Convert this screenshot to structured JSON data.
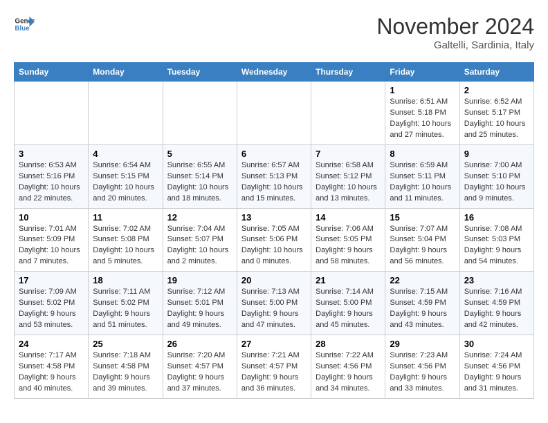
{
  "header": {
    "logo_line1": "General",
    "logo_line2": "Blue",
    "month": "November 2024",
    "location": "Galtelli, Sardinia, Italy"
  },
  "weekdays": [
    "Sunday",
    "Monday",
    "Tuesday",
    "Wednesday",
    "Thursday",
    "Friday",
    "Saturday"
  ],
  "weeks": [
    [
      {
        "day": "",
        "info": ""
      },
      {
        "day": "",
        "info": ""
      },
      {
        "day": "",
        "info": ""
      },
      {
        "day": "",
        "info": ""
      },
      {
        "day": "",
        "info": ""
      },
      {
        "day": "1",
        "info": "Sunrise: 6:51 AM\nSunset: 5:18 PM\nDaylight: 10 hours and 27 minutes."
      },
      {
        "day": "2",
        "info": "Sunrise: 6:52 AM\nSunset: 5:17 PM\nDaylight: 10 hours and 25 minutes."
      }
    ],
    [
      {
        "day": "3",
        "info": "Sunrise: 6:53 AM\nSunset: 5:16 PM\nDaylight: 10 hours and 22 minutes."
      },
      {
        "day": "4",
        "info": "Sunrise: 6:54 AM\nSunset: 5:15 PM\nDaylight: 10 hours and 20 minutes."
      },
      {
        "day": "5",
        "info": "Sunrise: 6:55 AM\nSunset: 5:14 PM\nDaylight: 10 hours and 18 minutes."
      },
      {
        "day": "6",
        "info": "Sunrise: 6:57 AM\nSunset: 5:13 PM\nDaylight: 10 hours and 15 minutes."
      },
      {
        "day": "7",
        "info": "Sunrise: 6:58 AM\nSunset: 5:12 PM\nDaylight: 10 hours and 13 minutes."
      },
      {
        "day": "8",
        "info": "Sunrise: 6:59 AM\nSunset: 5:11 PM\nDaylight: 10 hours and 11 minutes."
      },
      {
        "day": "9",
        "info": "Sunrise: 7:00 AM\nSunset: 5:10 PM\nDaylight: 10 hours and 9 minutes."
      }
    ],
    [
      {
        "day": "10",
        "info": "Sunrise: 7:01 AM\nSunset: 5:09 PM\nDaylight: 10 hours and 7 minutes."
      },
      {
        "day": "11",
        "info": "Sunrise: 7:02 AM\nSunset: 5:08 PM\nDaylight: 10 hours and 5 minutes."
      },
      {
        "day": "12",
        "info": "Sunrise: 7:04 AM\nSunset: 5:07 PM\nDaylight: 10 hours and 2 minutes."
      },
      {
        "day": "13",
        "info": "Sunrise: 7:05 AM\nSunset: 5:06 PM\nDaylight: 10 hours and 0 minutes."
      },
      {
        "day": "14",
        "info": "Sunrise: 7:06 AM\nSunset: 5:05 PM\nDaylight: 9 hours and 58 minutes."
      },
      {
        "day": "15",
        "info": "Sunrise: 7:07 AM\nSunset: 5:04 PM\nDaylight: 9 hours and 56 minutes."
      },
      {
        "day": "16",
        "info": "Sunrise: 7:08 AM\nSunset: 5:03 PM\nDaylight: 9 hours and 54 minutes."
      }
    ],
    [
      {
        "day": "17",
        "info": "Sunrise: 7:09 AM\nSunset: 5:02 PM\nDaylight: 9 hours and 53 minutes."
      },
      {
        "day": "18",
        "info": "Sunrise: 7:11 AM\nSunset: 5:02 PM\nDaylight: 9 hours and 51 minutes."
      },
      {
        "day": "19",
        "info": "Sunrise: 7:12 AM\nSunset: 5:01 PM\nDaylight: 9 hours and 49 minutes."
      },
      {
        "day": "20",
        "info": "Sunrise: 7:13 AM\nSunset: 5:00 PM\nDaylight: 9 hours and 47 minutes."
      },
      {
        "day": "21",
        "info": "Sunrise: 7:14 AM\nSunset: 5:00 PM\nDaylight: 9 hours and 45 minutes."
      },
      {
        "day": "22",
        "info": "Sunrise: 7:15 AM\nSunset: 4:59 PM\nDaylight: 9 hours and 43 minutes."
      },
      {
        "day": "23",
        "info": "Sunrise: 7:16 AM\nSunset: 4:59 PM\nDaylight: 9 hours and 42 minutes."
      }
    ],
    [
      {
        "day": "24",
        "info": "Sunrise: 7:17 AM\nSunset: 4:58 PM\nDaylight: 9 hours and 40 minutes."
      },
      {
        "day": "25",
        "info": "Sunrise: 7:18 AM\nSunset: 4:58 PM\nDaylight: 9 hours and 39 minutes."
      },
      {
        "day": "26",
        "info": "Sunrise: 7:20 AM\nSunset: 4:57 PM\nDaylight: 9 hours and 37 minutes."
      },
      {
        "day": "27",
        "info": "Sunrise: 7:21 AM\nSunset: 4:57 PM\nDaylight: 9 hours and 36 minutes."
      },
      {
        "day": "28",
        "info": "Sunrise: 7:22 AM\nSunset: 4:56 PM\nDaylight: 9 hours and 34 minutes."
      },
      {
        "day": "29",
        "info": "Sunrise: 7:23 AM\nSunset: 4:56 PM\nDaylight: 9 hours and 33 minutes."
      },
      {
        "day": "30",
        "info": "Sunrise: 7:24 AM\nSunset: 4:56 PM\nDaylight: 9 hours and 31 minutes."
      }
    ]
  ]
}
